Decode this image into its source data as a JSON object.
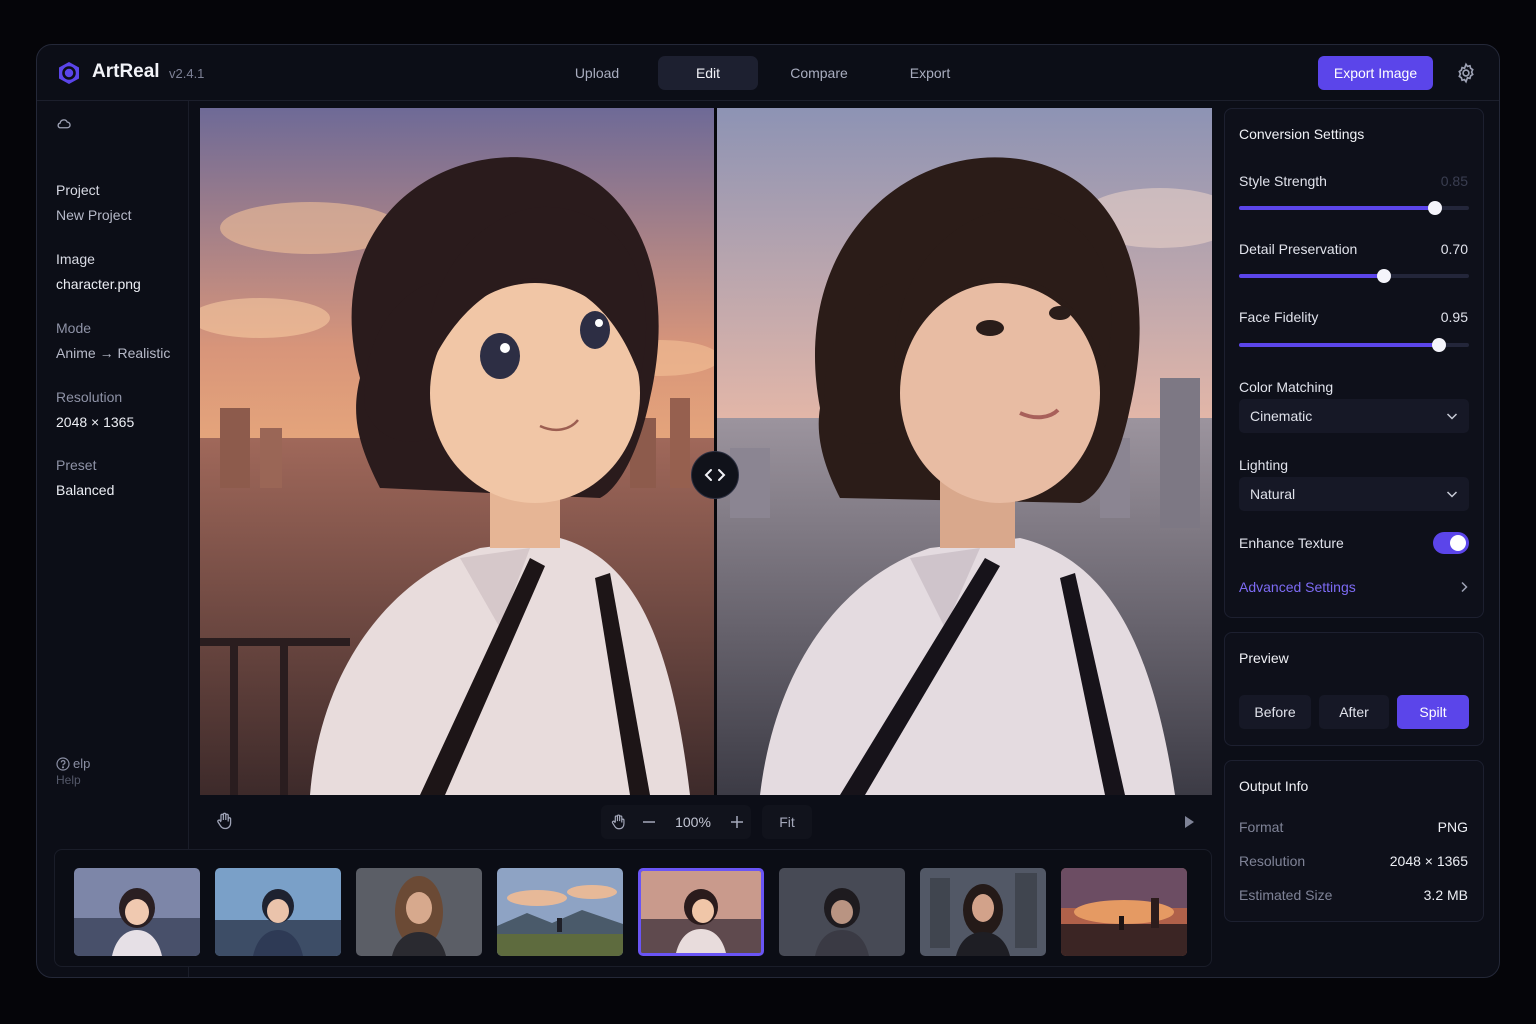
{
  "app": {
    "name": "ArtReal",
    "version": "v2.4.1"
  },
  "nav": {
    "tabs": [
      "Upload",
      "Edit",
      "Compare",
      "Export"
    ],
    "active": "Edit"
  },
  "header": {
    "export_label": "Export Image"
  },
  "sidebar": {
    "items": [
      {
        "label": "Project",
        "value": "New Project"
      },
      {
        "label": "Image",
        "value": "character.png"
      },
      {
        "label": "Mode",
        "value": "Anime → Realistic"
      },
      {
        "label": "Resolution",
        "value": "2048 × 1365"
      },
      {
        "label": "Preset",
        "value": "Balanced"
      }
    ],
    "help_label": "elp",
    "help_sub": "Help"
  },
  "viewer": {
    "zoom": "100%",
    "fit_label": "Fit",
    "split_position": 0.51
  },
  "thumbnails": {
    "count": 8,
    "selected_index": 4
  },
  "conversion": {
    "title": "Conversion Settings",
    "sliders": [
      {
        "label": "Style Strength",
        "value": "0.85",
        "level": 0.85
      },
      {
        "label": "Detail Preservation",
        "value": "0.70",
        "level": 0.63
      },
      {
        "label": "Face Fidelity",
        "value": "0.95",
        "level": 0.87
      }
    ],
    "color_matching": {
      "label": "Color Matching",
      "value": "Cinematic"
    },
    "lighting": {
      "label": "Lighting",
      "value": "Natural"
    },
    "enhance_texture": {
      "label": "Enhance Texture",
      "on": true
    },
    "advanced_label": "Advanced Settings"
  },
  "preview": {
    "title": "Preview",
    "options": [
      "Before",
      "After",
      "Spilt"
    ],
    "active": "Spilt"
  },
  "output": {
    "title": "Output Info",
    "rows": [
      {
        "label": "Format",
        "value": "PNG"
      },
      {
        "label": "Resolution",
        "value": "2048 × 1365"
      },
      {
        "label": "Estimated Size",
        "value": "3.2 MB"
      }
    ]
  },
  "colors": {
    "accent": "#5b45ea",
    "accent_text": "#7d6bf4",
    "bg": "#0c0e17",
    "panel": "#0e101a"
  },
  "icons": {
    "logo": "hexagon-logo-icon",
    "gear": "gear-icon",
    "project": "cloud-icon",
    "help": "help-icon",
    "hand": "hand-icon",
    "zoom_out": "minus-icon",
    "zoom_in": "plus-icon",
    "play": "play-icon",
    "split": "chevron-left-right-icon",
    "dropdown": "chevron-down-icon",
    "link": "chevron-right-icon"
  }
}
